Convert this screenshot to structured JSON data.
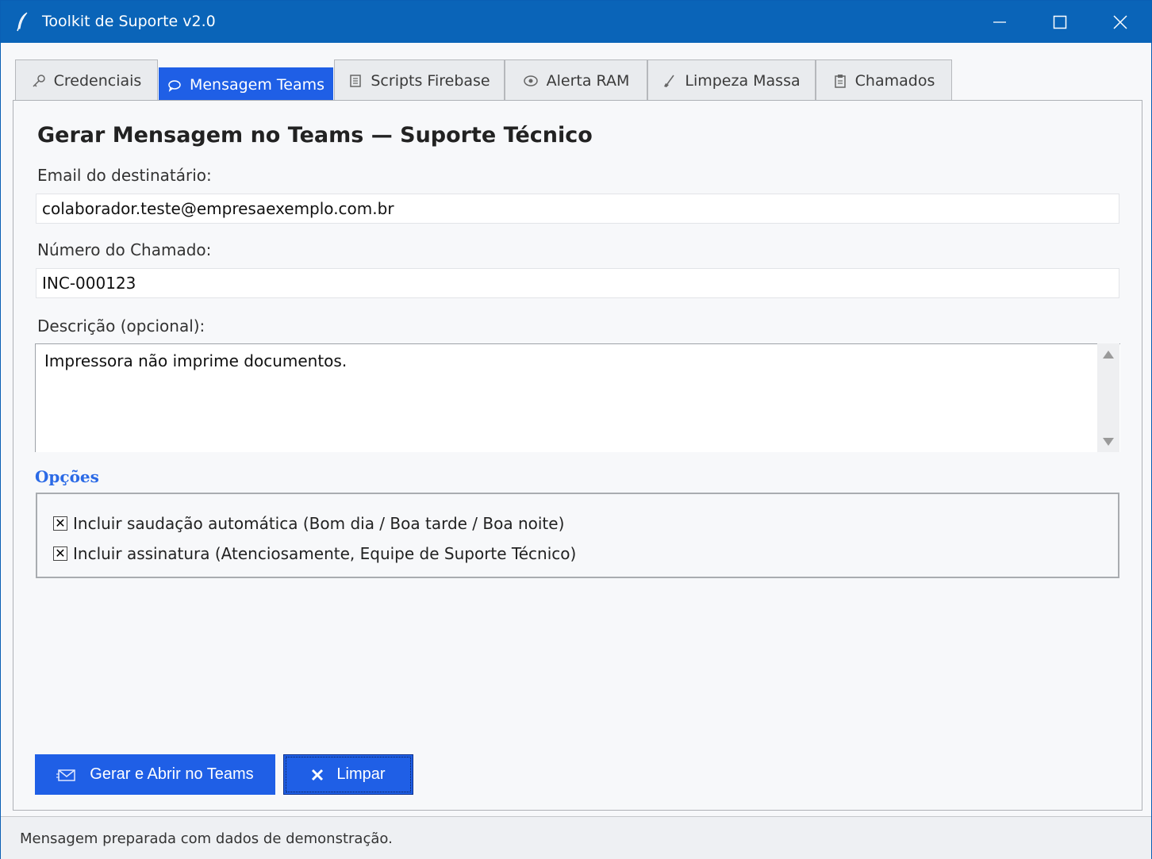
{
  "window": {
    "title": "Toolkit de Suporte v2.0"
  },
  "tabs": [
    {
      "label": "Credenciais",
      "icon": "key-icon",
      "active": false
    },
    {
      "label": "Mensagem Teams",
      "icon": "chat-bubble-icon",
      "active": true
    },
    {
      "label": "Scripts Firebase",
      "icon": "scroll-icon",
      "active": false
    },
    {
      "label": "Alerta RAM",
      "icon": "memory-icon",
      "active": false
    },
    {
      "label": "Limpeza Massa",
      "icon": "broom-icon",
      "active": false
    },
    {
      "label": "Chamados",
      "icon": "clipboard-icon",
      "active": false
    }
  ],
  "form": {
    "heading": "Gerar Mensagem no Teams — Suporte Técnico",
    "email_label": "Email do destinatário:",
    "email_value": "colaborador.teste@empresaexemplo.com.br",
    "ticket_label": "Número do Chamado:",
    "ticket_value": "INC-000123",
    "desc_label": "Descrição (opcional):",
    "desc_value": "Impressora não imprime documentos."
  },
  "options": {
    "title": "Opções",
    "items": [
      {
        "label": "Incluir saudação automática (Bom dia / Boa tarde / Boa noite)",
        "checked": true
      },
      {
        "label": "Incluir assinatura (Atenciosamente, Equipe de Suporte Técnico)",
        "checked": true
      }
    ]
  },
  "buttons": {
    "generate": "Gerar e Abrir no Teams",
    "clear": "Limpar"
  },
  "status": {
    "text": "Mensagem preparada com dados de demonstração."
  },
  "colors": {
    "titlebar": "#0a64b8",
    "accent": "#1f5fe6",
    "options_title": "#2b6ae6"
  }
}
